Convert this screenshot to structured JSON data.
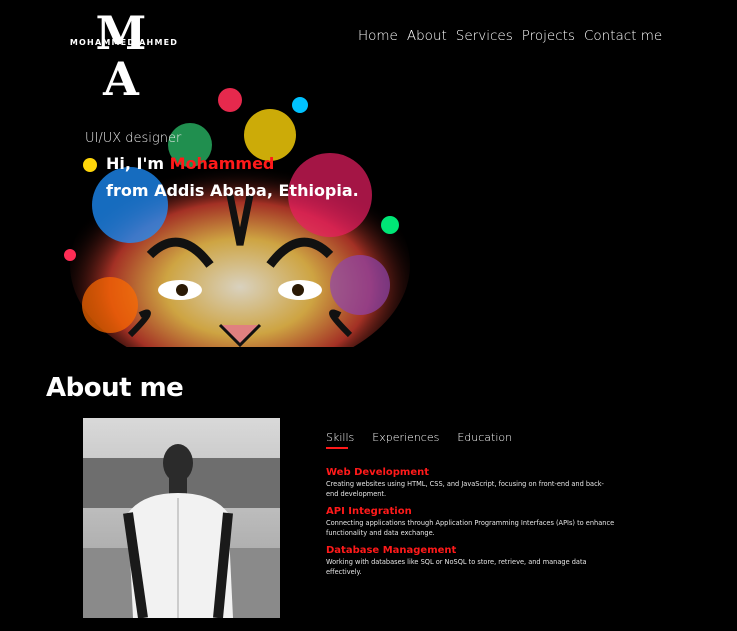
{
  "logo": {
    "monogram": "M A",
    "name": "MOHAMMED AHMED"
  },
  "nav": [
    "Home",
    "About",
    "Services",
    "Projects",
    "Contact me"
  ],
  "hero": {
    "role": "UI/UX designer",
    "greeting_prefix": "Hi, I'm ",
    "name": "Mohammed",
    "line2": "from Addis Ababa, Ethiopia."
  },
  "about": {
    "title": "About me",
    "tabs": [
      "Skills",
      "Experiences",
      "Education"
    ],
    "active_tab": "Skills",
    "skills": [
      {
        "title": "Web Development",
        "desc": "Creating websites using HTML, CSS, and JavaScript, focusing on front-end and back-end development."
      },
      {
        "title": "API Integration",
        "desc": "Connecting applications through Application Programming Interfaces (APIs) to enhance functionality and data exchange."
      },
      {
        "title": "Database Management",
        "desc": "Working with databases like SQL or NoSQL to store, retrieve, and manage data effectively."
      }
    ]
  },
  "colors": {
    "accent": "#ff1a1a",
    "background": "#000000"
  }
}
